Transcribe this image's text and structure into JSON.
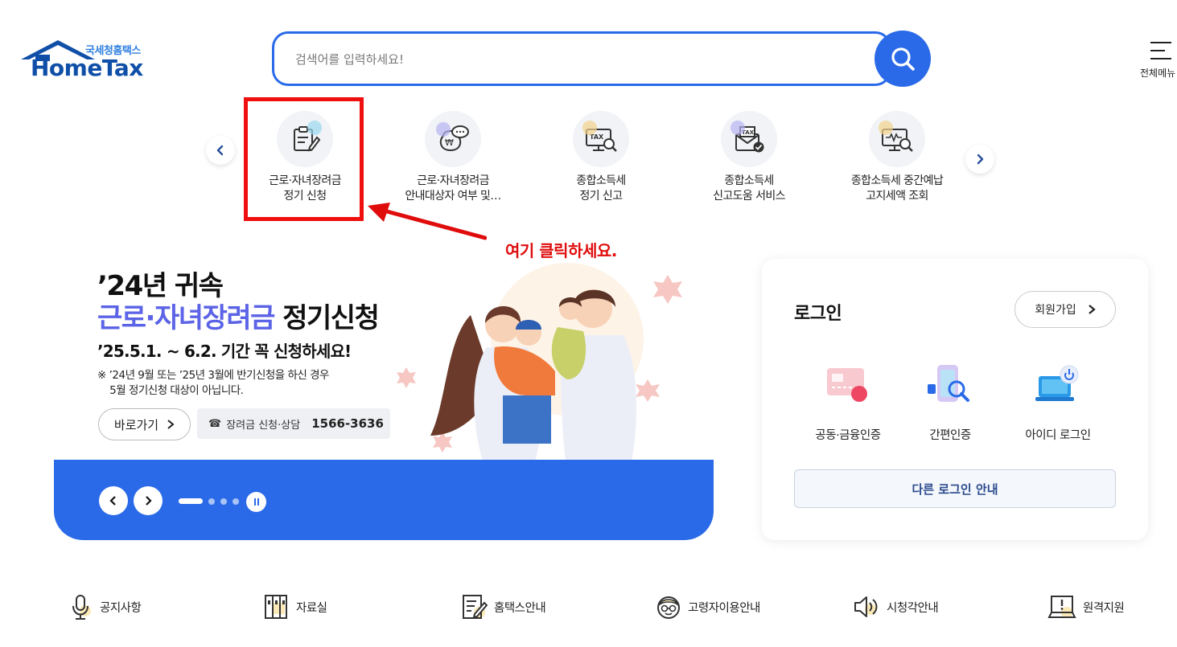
{
  "header": {
    "logo_kor": "국세청홈택스",
    "logo_en": "HomeTax",
    "search_placeholder": "검색어를 입력하세요!",
    "all_menu": "전체메뉴"
  },
  "quick_menu": {
    "items": [
      {
        "line1": "근로·자녀장려금",
        "line2": "정기 신청",
        "icon": "form-edit-icon"
      },
      {
        "line1": "근로·자녀장려금",
        "line2": "안내대상자 여부 및…",
        "icon": "money-chat-icon"
      },
      {
        "line1": "종합소득세",
        "line2": "정기 신고",
        "icon": "tax-monitor-icon"
      },
      {
        "line1": "종합소득세",
        "line2": "신고도움 서비스",
        "icon": "tax-mail-check-icon"
      },
      {
        "line1": "종합소득세 중간예납",
        "line2": "고지세액 조회",
        "icon": "won-monitor-search-icon"
      }
    ]
  },
  "annotation": {
    "text": "여기 클릭하세요."
  },
  "banner": {
    "title1": "’24년 귀속",
    "title2_highlight": "근로·자녀장려금",
    "title2_normal": " 정기신청",
    "subtitle": "’25.5.1. ~ 6.2. 기간 꼭 신청하세요!",
    "note": "※ ’24년 9월 또는 ’25년 3월에 반기신청을 하신 경우\n    5월 정기신청 대상이 아닙니다.",
    "go_button": "바로가기",
    "tel_label": "장려금 신청·상담",
    "tel_number": "1566-3636",
    "slide_total": 4,
    "slide_active": 1
  },
  "login": {
    "title": "로그인",
    "join_button": "회원가입",
    "options": [
      {
        "label": "공동·금융인증",
        "icon": "certificate-card-icon"
      },
      {
        "label": "간편인증",
        "icon": "phone-search-icon"
      },
      {
        "label": "아이디 로그인",
        "icon": "laptop-power-icon"
      }
    ],
    "other_login": "다른 로그인 안내"
  },
  "bottom_links": [
    {
      "label": "공지사항",
      "icon": "microphone-icon"
    },
    {
      "label": "자료실",
      "icon": "archive-icon"
    },
    {
      "label": "홈택스안내",
      "icon": "document-edit-icon"
    },
    {
      "label": "고령자이용안내",
      "icon": "senior-icon"
    },
    {
      "label": "시청각안내",
      "icon": "speaker-icon"
    },
    {
      "label": "원격지원",
      "icon": "remote-support-icon"
    }
  ],
  "colors": {
    "primary": "#2a6ae8",
    "logo_dark": "#0f4fa8",
    "highlight_text": "#5b63e6",
    "annotation_red": "#e00c0c"
  }
}
